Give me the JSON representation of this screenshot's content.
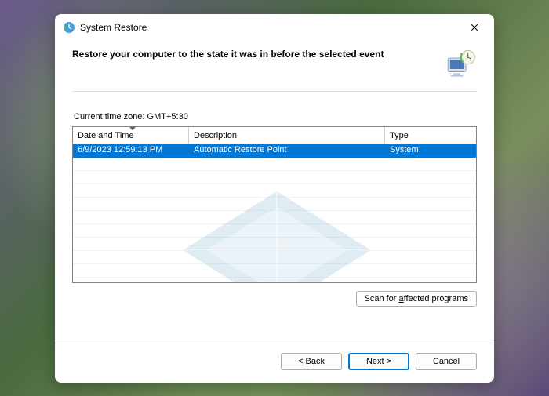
{
  "titlebar": {
    "title": "System Restore"
  },
  "heading": "Restore your computer to the state it was in before the selected event",
  "timezone_label": "Current time zone: GMT+5:30",
  "table": {
    "columns": {
      "date_time": "Date and Time",
      "description": "Description",
      "type": "Type"
    },
    "rows": [
      {
        "date_time": "6/9/2023 12:59:13 PM",
        "description": "Automatic Restore Point",
        "type": "System",
        "selected": true
      }
    ]
  },
  "buttons": {
    "scan": "Scan for affected programs",
    "back": "< Back",
    "next": "Next >",
    "cancel": "Cancel"
  }
}
